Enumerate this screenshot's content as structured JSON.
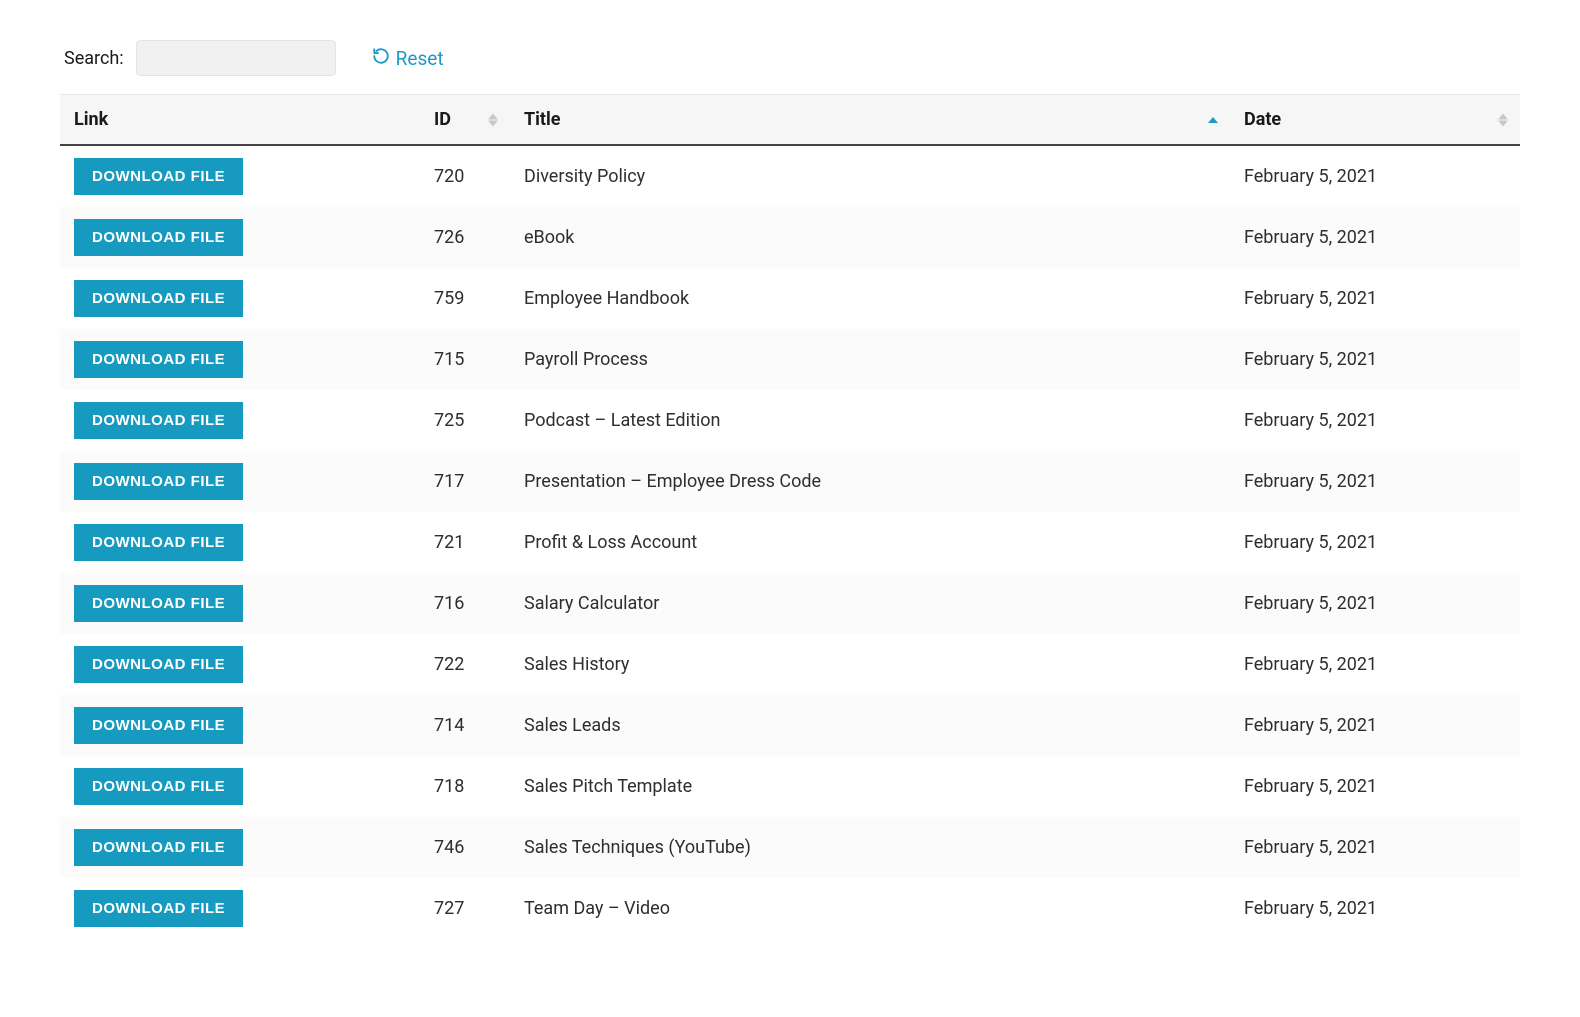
{
  "toolbar": {
    "search_label": "Search:",
    "search_value": "",
    "reset_label": "Reset"
  },
  "columns": {
    "link": "Link",
    "id": "ID",
    "title": "Title",
    "date": "Date"
  },
  "download_label": "DOWNLOAD FILE",
  "rows": [
    {
      "id": "720",
      "title": "Diversity Policy",
      "date": "February 5, 2021"
    },
    {
      "id": "726",
      "title": "eBook",
      "date": "February 5, 2021"
    },
    {
      "id": "759",
      "title": "Employee Handbook",
      "date": "February 5, 2021"
    },
    {
      "id": "715",
      "title": "Payroll Process",
      "date": "February 5, 2021"
    },
    {
      "id": "725",
      "title": "Podcast – Latest Edition",
      "date": "February 5, 2021"
    },
    {
      "id": "717",
      "title": "Presentation – Employee Dress Code",
      "date": "February 5, 2021"
    },
    {
      "id": "721",
      "title": "Profit & Loss Account",
      "date": "February 5, 2021"
    },
    {
      "id": "716",
      "title": "Salary Calculator",
      "date": "February 5, 2021"
    },
    {
      "id": "722",
      "title": "Sales History",
      "date": "February 5, 2021"
    },
    {
      "id": "714",
      "title": "Sales Leads",
      "date": "February 5, 2021"
    },
    {
      "id": "718",
      "title": "Sales Pitch Template",
      "date": "February 5, 2021"
    },
    {
      "id": "746",
      "title": "Sales Techniques (YouTube)",
      "date": "February 5, 2021"
    },
    {
      "id": "727",
      "title": "Team Day – Video",
      "date": "February 5, 2021"
    }
  ]
}
